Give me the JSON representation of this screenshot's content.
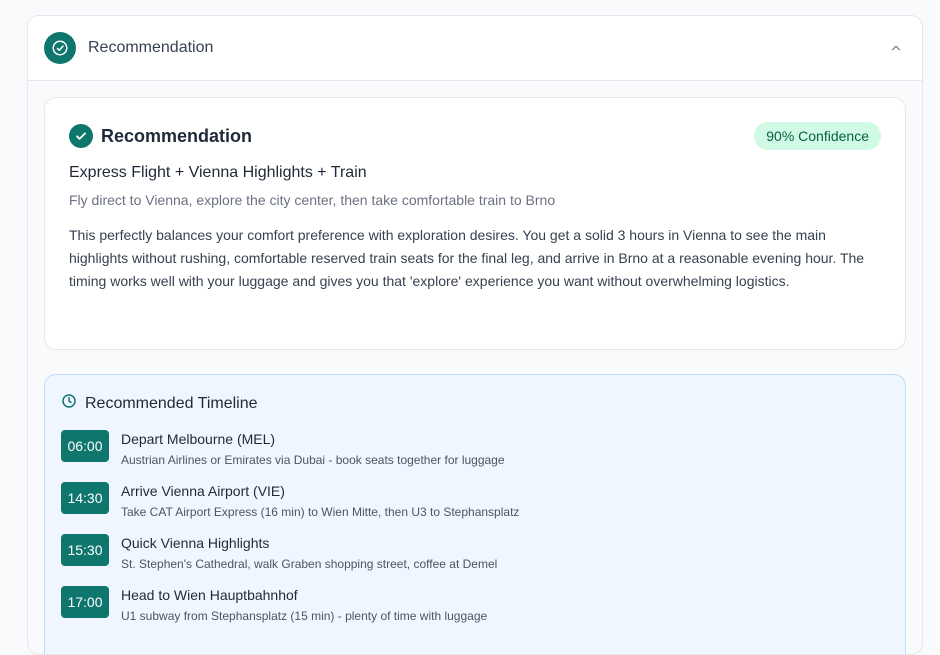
{
  "panel": {
    "header_title": "Recommendation"
  },
  "recommendation": {
    "title": "Recommendation",
    "confidence": "90% Confidence",
    "option_title": "Express Flight + Vienna Highlights + Train",
    "option_subtitle": "Fly direct to Vienna, explore the city center, then take comfortable train to Brno",
    "description": "This perfectly balances your comfort preference with exploration desires. You get a solid 3 hours in Vienna to see the main highlights without rushing, comfortable reserved train seats for the final leg, and arrive in Brno at a reasonable evening hour. The timing works well with your luggage and gives you that 'explore' experience you want without overwhelming logistics."
  },
  "timeline": {
    "title": "Recommended Timeline",
    "items": [
      {
        "time": "06:00",
        "event": "Depart Melbourne (MEL)",
        "detail": "Austrian Airlines or Emirates via Dubai - book seats together for luggage"
      },
      {
        "time": "14:30",
        "event": "Arrive Vienna Airport (VIE)",
        "detail": "Take CAT Airport Express (16 min) to Wien Mitte, then U3 to Stephansplatz"
      },
      {
        "time": "15:30",
        "event": "Quick Vienna Highlights",
        "detail": "St. Stephen's Cathedral, walk Graben shopping street, coffee at Demel"
      },
      {
        "time": "17:00",
        "event": "Head to Wien Hauptbahnhof",
        "detail": "U1 subway from Stephansplatz (15 min) - plenty of time with luggage"
      }
    ]
  },
  "colors": {
    "accent": "#0f766e",
    "badge_bg": "#d1fae5",
    "timeline_bg": "#eff6ff"
  }
}
